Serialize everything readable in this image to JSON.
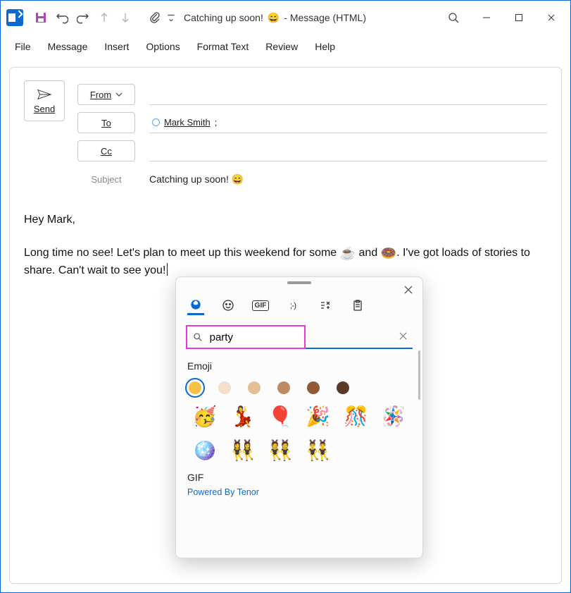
{
  "titlebar": {
    "title_main": "Catching up soon!",
    "title_emoji": "😄",
    "title_suffix": " -  Message (HTML)"
  },
  "menu": {
    "file": "File",
    "message": "Message",
    "insert": "Insert",
    "options": "Options",
    "format_text": "Format Text",
    "review": "Review",
    "help": "Help"
  },
  "compose": {
    "send": "Send",
    "from": "From",
    "to": "To",
    "cc": "Cc",
    "subject_label": "Subject",
    "subject_value": "Catching up soon!",
    "subject_emoji": "😄",
    "recipient_name": "Mark Smith",
    "recipient_suffix": ";"
  },
  "body": {
    "line1": "Hey Mark,",
    "line2_pre": "Long time no see! Let's plan to meet up this weekend for some ",
    "emoji1": "☕",
    "mid": " and ",
    "emoji2": "🍩",
    "line2_post": ". I've got loads of stories to share. Can't wait to see you!"
  },
  "emoji_panel": {
    "search_value": "party",
    "section_emoji": "Emoji",
    "section_gif": "GIF",
    "tenor": "Powered By Tenor",
    "tabs": {
      "gif_label": "GIF",
      "kaomoji_label": ";-)"
    },
    "skin_tones": [
      "#f6c244",
      "#f6dfc8",
      "#e7bf94",
      "#bd8b61",
      "#8f5a36",
      "#5a3a27"
    ],
    "emojis": [
      "🥳",
      "💃",
      "🎈",
      "🎉",
      "🎊",
      "🪅",
      "🪩",
      "👯‍♀️",
      "👯",
      "👯‍♂️"
    ]
  }
}
